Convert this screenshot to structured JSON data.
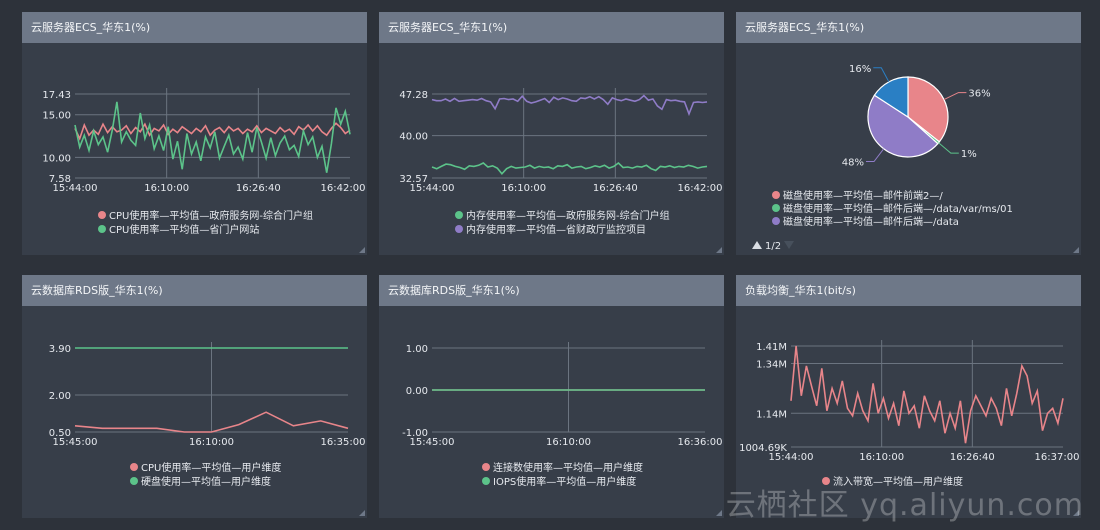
{
  "colors": {
    "red": "#e8858a",
    "green": "#5cc38a",
    "purple": "#8f7cc7",
    "blue": "#2a7fc4",
    "text": "#e6e9ee",
    "grid": "#6b7480"
  },
  "watermark": "云栖社区 yq.aliyun.com",
  "panels": [
    {
      "title": "云服务器ECS_华东1(%)",
      "chart_data": {
        "type": "line",
        "ylim": [
          7.58,
          17.43
        ],
        "yticks": [
          "17.43",
          "15.00",
          "10.00",
          "7.58"
        ],
        "ytick_values": [
          17.43,
          15.0,
          10.0,
          7.58
        ],
        "xticks": [
          "15:44:00",
          "16:10:00",
          "16:26:40",
          "16:42:00"
        ],
        "series": [
          {
            "name": "CPU使用率—平均值—政府服务网-综合门户组",
            "color": "red",
            "values": [
              13.4,
              12.2,
              13.8,
              12.6,
              13.2,
              12.7,
              13.9,
              12.9,
              13.6,
              13.0,
              13.2,
              13.7,
              12.8,
              13.5,
              13.0,
              13.9,
              12.6,
              13.4,
              13.1,
              13.8,
              12.7,
              13.3,
              12.9,
              13.6,
              13.2,
              12.8,
              13.4,
              13.0,
              13.7,
              12.6,
              13.2,
              13.5,
              12.9,
              13.6,
              13.1,
              13.4,
              12.8,
              13.3,
              13.0,
              13.7,
              12.9,
              13.4,
              13.1,
              12.8,
              13.5,
              13.0,
              13.3,
              12.7,
              13.6,
              13.2,
              13.8,
              13.1,
              13.7,
              13.0,
              12.6,
              13.4,
              14.0,
              13.5,
              12.8,
              13.2
            ]
          },
          {
            "name": "CPU使用率—平均值—省门户网站",
            "color": "green",
            "values": [
              13.8,
              11.2,
              12.6,
              10.8,
              13.1,
              11.5,
              12.4,
              10.6,
              13.2,
              16.5,
              11.8,
              13.0,
              12.0,
              11.4,
              15.2,
              12.2,
              13.8,
              11.0,
              12.5,
              10.8,
              13.6,
              9.8,
              11.9,
              8.6,
              12.8,
              10.4,
              11.8,
              9.6,
              12.4,
              11.1,
              13.0,
              9.9,
              11.3,
              12.6,
              10.4,
              11.2,
              9.8,
              12.9,
              10.6,
              13.5,
              11.8,
              9.9,
              12.3,
              10.2,
              11.7,
              12.5,
              10.9,
              11.4,
              10.1,
              13.1,
              11.5,
              12.4,
              10.0,
              11.3,
              8.2,
              11.6,
              15.8,
              13.9,
              15.4,
              12.7
            ]
          }
        ]
      }
    },
    {
      "title": "云服务器ECS_华东1(%)",
      "chart_data": {
        "type": "line",
        "ylim": [
          32.57,
          47.28
        ],
        "yticks": [
          "47.28",
          "40.00",
          "32.57"
        ],
        "ytick_values": [
          47.28,
          40.0,
          32.57
        ],
        "xticks": [
          "15:44:00",
          "16:10:00",
          "16:26:40",
          "16:42:00"
        ],
        "series": [
          {
            "name": "内存使用率—平均值—政府服务网-综合门户组",
            "color": "green",
            "values": [
              34.5,
              34.2,
              34.6,
              35.0,
              34.9,
              34.6,
              34.4,
              34.1,
              34.7,
              34.6,
              34.8,
              35.2,
              34.5,
              34.7,
              34.3,
              33.3,
              34.2,
              34.6,
              34.3,
              34.4,
              34.5,
              34.8,
              34.3,
              34.6,
              34.4,
              34.5,
              34.2,
              34.7,
              34.6,
              34.9,
              34.3,
              34.5,
              34.6,
              34.2,
              34.4,
              34.7,
              34.5,
              34.8,
              34.3,
              34.6,
              35.2,
              34.4,
              34.5,
              34.3,
              34.6,
              34.5,
              34.8,
              34.2,
              33.9,
              34.6,
              34.5,
              34.7,
              34.4,
              34.6,
              34.5,
              34.8,
              34.6,
              34.3,
              34.5,
              34.6
            ]
          },
          {
            "name": "内存使用率—平均值—省财政厅监控项目",
            "color": "purple",
            "values": [
              46.3,
              46.1,
              46.1,
              46.4,
              46.0,
              46.5,
              46.0,
              46.1,
              46.2,
              46.3,
              46.2,
              46.5,
              46.1,
              45.9,
              44.7,
              46.4,
              46.5,
              46.3,
              46.4,
              46.0,
              46.9,
              46.0,
              45.7,
              45.9,
              46.2,
              46.5,
              45.8,
              46.7,
              46.3,
              46.6,
              46.4,
              46.1,
              46.0,
              46.6,
              46.5,
              46.8,
              46.4,
              46.8,
              46.3,
              45.5,
              46.6,
              46.3,
              46.1,
              46.4,
              46.2,
              46.0,
              46.3,
              47.0,
              46.2,
              46.4,
              45.2,
              44.6,
              46.3,
              46.1,
              46.2,
              46.0,
              45.9,
              43.8,
              45.8,
              45.9,
              45.8,
              45.9
            ]
          }
        ]
      }
    },
    {
      "title": "云服务器ECS_华东1(%)",
      "chart_data": {
        "type": "pie",
        "slices": [
          {
            "name": "磁盘使用率—平均值—邮件前端2—/",
            "value": 36,
            "label": "36%",
            "color": "red"
          },
          {
            "name": "磁盘使用率—平均值—邮件后端—/data/var/ms/01",
            "value": 1,
            "label": "1%",
            "color": "green"
          },
          {
            "name": "磁盘使用率—平均值—邮件后端—/data",
            "value": 48,
            "label": "48%",
            "color": "purple"
          },
          {
            "name": "",
            "value": 16,
            "label": "16%",
            "color": "blue"
          }
        ],
        "pager": "1/2"
      }
    },
    {
      "title": "云数据库RDS版_华东1(%)",
      "chart_data": {
        "type": "line",
        "ylim": [
          0.5,
          3.9
        ],
        "yticks": [
          "3.90",
          "2.00",
          "0.50"
        ],
        "ytick_values": [
          3.9,
          2.0,
          0.5
        ],
        "xticks": [
          "15:45:00",
          "16:10:00",
          "16:35:00"
        ],
        "series": [
          {
            "name": "CPU使用率—平均值—用户维度",
            "color": "red",
            "values": [
              0.75,
              0.65,
              0.65,
              0.65,
              0.5,
              0.5,
              0.8,
              1.3,
              0.75,
              0.95,
              0.65
            ]
          },
          {
            "name": "硬盘使用—平均值—用户维度",
            "color": "green",
            "values": [
              3.9,
              3.9,
              3.9,
              3.9,
              3.9,
              3.9,
              3.9,
              3.9,
              3.9,
              3.9,
              3.9
            ]
          }
        ]
      }
    },
    {
      "title": "云数据库RDS版_华东1(%)",
      "chart_data": {
        "type": "line",
        "ylim": [
          -1.0,
          1.0
        ],
        "yticks": [
          "1.00",
          "0.00",
          "-1.00"
        ],
        "ytick_values": [
          1.0,
          0.0,
          -1.0
        ],
        "xticks": [
          "15:45:00",
          "16:10:00",
          "16:36:00"
        ],
        "series": [
          {
            "name": "连接数使用率—平均值—用户维度",
            "color": "red",
            "values": [
              0,
              0,
              0,
              0,
              0,
              0,
              0,
              0,
              0,
              0,
              0
            ]
          },
          {
            "name": "IOPS使用率—平均值—用户维度",
            "color": "green",
            "values": [
              0,
              0,
              0,
              0,
              0,
              0,
              0,
              0,
              0,
              0,
              0
            ]
          }
        ]
      }
    },
    {
      "title": "负载均衡_华东1(bit/s)",
      "chart_data": {
        "type": "line",
        "ylim": [
          1004690,
          1410000
        ],
        "yticks": [
          "1.41M",
          "1.34M",
          "1.14M",
          "1004.69K"
        ],
        "ytick_values": [
          1410000,
          1340000,
          1140000,
          1004690
        ],
        "xticks": [
          "15:44:00",
          "16:10:00",
          "16:26:40",
          "16:37:00"
        ],
        "series": [
          {
            "name": "流入带宽—平均值—用户维度",
            "color": "red",
            "values": [
              1190000,
              1410000,
              1210000,
              1330000,
              1250000,
              1170000,
              1320000,
              1150000,
              1240000,
              1180000,
              1270000,
              1160000,
              1130000,
              1220000,
              1150000,
              1110000,
              1260000,
              1140000,
              1200000,
              1120000,
              1180000,
              1090000,
              1230000,
              1140000,
              1170000,
              1080000,
              1210000,
              1150000,
              1110000,
              1190000,
              1060000,
              1140000,
              1080000,
              1190000,
              1020000,
              1150000,
              1210000,
              1170000,
              1130000,
              1200000,
              1160000,
              1090000,
              1240000,
              1130000,
              1220000,
              1330000,
              1290000,
              1180000,
              1230000,
              1070000,
              1140000,
              1160000,
              1100000,
              1200000
            ]
          }
        ]
      }
    }
  ]
}
